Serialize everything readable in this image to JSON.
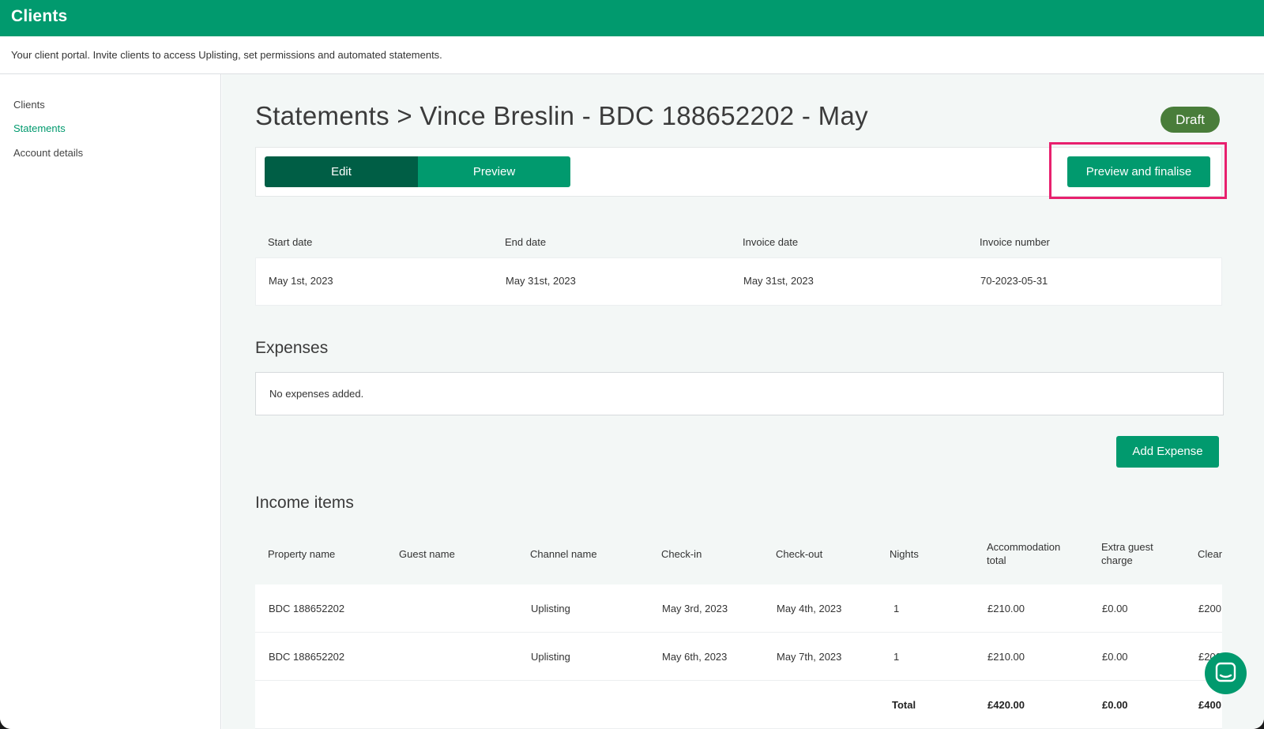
{
  "header": {
    "title": "Clients"
  },
  "subheader": {
    "text": "Your client portal. Invite clients to access Uplisting, set permissions and automated statements."
  },
  "sidebar": {
    "items": [
      {
        "label": "Clients",
        "active": false
      },
      {
        "label": "Statements",
        "active": true
      },
      {
        "label": "Account details",
        "active": false
      }
    ]
  },
  "page": {
    "title": "Statements > Vince Breslin - BDC 188652202 - May",
    "status": "Draft"
  },
  "toolbar": {
    "edit_label": "Edit",
    "preview_label": "Preview",
    "finalise_label": "Preview and finalise"
  },
  "dates": {
    "headers": [
      "Start date",
      "End date",
      "Invoice date",
      "Invoice number"
    ],
    "values": [
      "May 1st, 2023",
      "May 31st, 2023",
      "May 31st, 2023",
      "70-2023-05-31"
    ]
  },
  "expenses": {
    "title": "Expenses",
    "empty_text": "No expenses added.",
    "add_label": "Add Expense"
  },
  "income": {
    "title": "Income items",
    "headers": [
      "Property name",
      "Guest name",
      "Channel name",
      "Check-in",
      "Check-out",
      "Nights",
      "Accommodation total",
      "Extra guest charge",
      "Cleaning"
    ],
    "rows": [
      [
        "BDC 188652202",
        "",
        "Uplisting",
        "May 3rd, 2023",
        "May 4th, 2023",
        "1",
        "£210.00",
        "£0.00",
        "£200"
      ],
      [
        "BDC 188652202",
        "",
        "Uplisting",
        "May 6th, 2023",
        "May 7th, 2023",
        "1",
        "£210.00",
        "£0.00",
        "£200"
      ]
    ],
    "total": {
      "label": "Total",
      "accommodation": "£420.00",
      "extra_guest": "£0.00",
      "cleaning": "£400"
    }
  },
  "colors": {
    "brand": "#019a6e",
    "brand_dark": "#005e45",
    "draft": "#497d3a",
    "highlight": "#e8206e"
  },
  "icons": {
    "chat": "chat-bubble-icon"
  }
}
